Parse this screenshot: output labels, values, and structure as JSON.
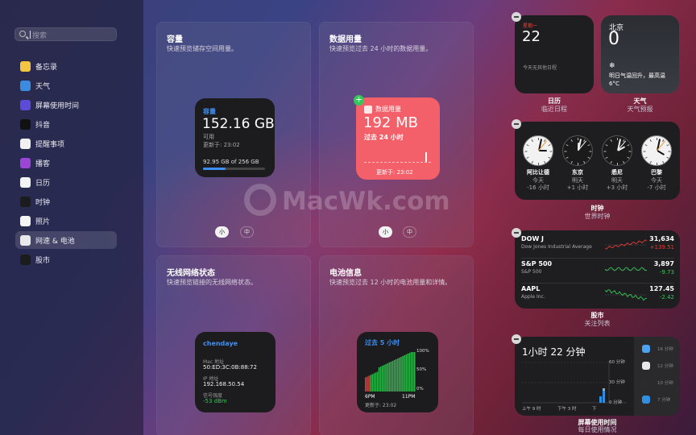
{
  "sidebar": {
    "search_placeholder": "搜索",
    "items": [
      {
        "label": "备忘录",
        "icon": "notes-icon",
        "color": "#f5c542"
      },
      {
        "label": "天气",
        "icon": "weather-icon",
        "color": "#3b8be0"
      },
      {
        "label": "屏幕使用时间",
        "icon": "screen-time-icon",
        "color": "#5b4bd8"
      },
      {
        "label": "抖音",
        "icon": "douyin-icon",
        "color": "#111111"
      },
      {
        "label": "提醒事项",
        "icon": "reminders-icon",
        "color": "#f0f0f0"
      },
      {
        "label": "播客",
        "icon": "podcasts-icon",
        "color": "#9b45d6"
      },
      {
        "label": "日历",
        "icon": "calendar-icon",
        "color": "#f4f4f4"
      },
      {
        "label": "时钟",
        "icon": "clock-icon",
        "color": "#1c1c1c"
      },
      {
        "label": "照片",
        "icon": "photos-icon",
        "color": "#f4f4f4"
      },
      {
        "label": "网速 & 电池",
        "icon": "netspeed-battery-icon",
        "color": "#e9e9e9",
        "selected": true
      },
      {
        "label": "股市",
        "icon": "stocks-icon",
        "color": "#1c1c1c"
      }
    ]
  },
  "panels": {
    "capacity": {
      "title": "容量",
      "subtitle": "快速预览储存空间用量。",
      "widget": {
        "heading": "容量",
        "value": "152.16 GB",
        "avail": "可用",
        "updated": "更新于: 23:02",
        "usage": "92.95 GB of 256 GB",
        "fraction": 0.36
      },
      "sizes": [
        "小",
        "中"
      ]
    },
    "datausage": {
      "title": "数据用量",
      "subtitle": "快速预览过去 24 小时的数据用量。",
      "widget": {
        "heading": "数据用量",
        "value": "192 MB",
        "period": "过去 24 小时",
        "updated": "更新于: 23:02"
      },
      "sizes": [
        "小",
        "中"
      ]
    },
    "wifi": {
      "title": "无线网络状态",
      "subtitle": "快速预览链接的无线网络状态。",
      "widget": {
        "ssid": "chendaye",
        "mac_label": "Mac 地址",
        "mac": "50:ED:3C:0B:88:72",
        "ip_label": "IP 地址",
        "ip": "192.168.50.54",
        "signal_label": "信号强度",
        "signal": "-53 dBm"
      }
    },
    "battery": {
      "title": "电池信息",
      "subtitle": "快速预览过去 12 小时的电池用量和详情。",
      "widget": {
        "heading": "过去 5 小时",
        "y_labels": [
          "100%",
          "50%",
          "0%"
        ],
        "x_labels": [
          "6PM",
          "11PM"
        ],
        "updated": "更新于: 23:02"
      }
    }
  },
  "right": {
    "calendar": {
      "weekday": "星期一",
      "day": "22",
      "events": "今天无其他日程",
      "caption": "日历",
      "subcaption": "临近日程"
    },
    "weather": {
      "city": "北京",
      "temp": "0",
      "icon": "snowflake-icon",
      "forecast": "明日气温回升，最高温 6°C",
      "caption": "天气",
      "subcaption": "天气预报"
    },
    "clock": {
      "caption": "时钟",
      "subcaption": "世界时钟",
      "cities": [
        {
          "name": "阿比让德",
          "day": "今天",
          "offset": "-16 小时",
          "dark": false,
          "h": 3.0,
          "m": 2
        },
        {
          "name": "东京",
          "day": "明天",
          "offset": "+1 小时",
          "dark": true,
          "h": 12.0,
          "m": 2
        },
        {
          "name": "悉尼",
          "day": "明天",
          "offset": "+3 小时",
          "dark": true,
          "h": 2.0,
          "m": 2
        },
        {
          "name": "巴黎",
          "day": "今天",
          "offset": "-7 小时",
          "dark": false,
          "h": 4.0,
          "m": 2
        }
      ]
    },
    "stocks": {
      "caption": "股市",
      "subcaption": "关注列表",
      "rows": [
        {
          "symbol": "DOW J",
          "name": "Dow Jones Industrial Average",
          "price": "31,634",
          "change": "+139.51",
          "up": true
        },
        {
          "symbol": "S&P 500",
          "name": "S&P 500",
          "price": "3,897",
          "change": "-9.73",
          "up": false
        },
        {
          "symbol": "AAPL",
          "name": "Apple Inc.",
          "price": "127.45",
          "change": "-2.42",
          "up": false
        }
      ]
    },
    "screentime": {
      "caption": "屏幕使用时间",
      "subcaption": "每日使用情况",
      "total": "1小时 22 分钟",
      "y_labels": [
        "60 分钟",
        "30 分钟",
        "0 分钟"
      ],
      "x_labels": [
        "上午 9 时",
        "下午 3 时",
        "下"
      ],
      "apps": [
        {
          "icon": "finder-icon",
          "time": "16 分钟",
          "color": "#4aa3f0"
        },
        {
          "icon": "chrome-icon",
          "time": "12 分钟",
          "color": "#e8e8e8"
        },
        {
          "icon": "terminal-icon",
          "time": "10 分钟",
          "color": "#2b2b2b"
        },
        {
          "icon": "vscode-icon",
          "time": "7 分钟",
          "color": "#2f8fe0"
        }
      ]
    }
  },
  "watermark": "MacWk.com"
}
